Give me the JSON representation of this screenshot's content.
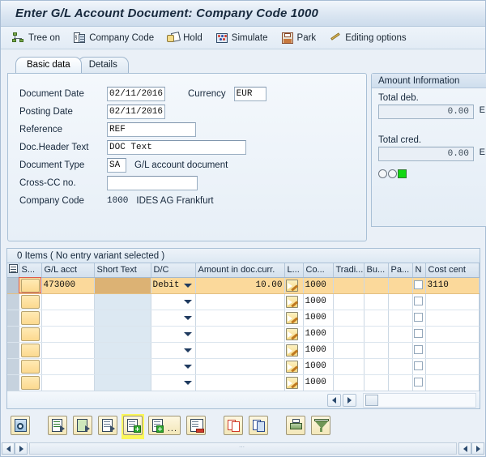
{
  "window": {
    "title": "Enter G/L Account Document: Company Code 1000"
  },
  "toolbar": {
    "items": [
      {
        "label": "Tree on",
        "icon": "tree-icon"
      },
      {
        "label": "Company Code",
        "icon": "company-code-icon"
      },
      {
        "label": "Hold",
        "icon": "hold-icon"
      },
      {
        "label": "Simulate",
        "icon": "simulate-icon"
      },
      {
        "label": "Park",
        "icon": "park-save-icon"
      },
      {
        "label": "Editing options",
        "icon": "pencil-icon"
      }
    ]
  },
  "tabs": [
    {
      "label": "Basic data",
      "active": true
    },
    {
      "label": "Details",
      "active": false
    }
  ],
  "basic_data": {
    "document_date": {
      "label": "Document Date",
      "value": "02/11/2016"
    },
    "currency": {
      "label": "Currency",
      "value": "EUR"
    },
    "posting_date": {
      "label": "Posting Date",
      "value": "02/11/2016"
    },
    "reference": {
      "label": "Reference",
      "value": "REF"
    },
    "doc_header_text": {
      "label": "Doc.Header Text",
      "value": "DOC Text"
    },
    "document_type": {
      "label": "Document Type",
      "value": "SA",
      "description": "G/L account document"
    },
    "cross_cc_no": {
      "label": "Cross-CC no.",
      "value": ""
    },
    "company_code": {
      "label": "Company Code",
      "value": "1000",
      "description": "IDES AG Frankfurt"
    }
  },
  "amount_information": {
    "header": "Amount Information",
    "total_debit": {
      "label": "Total deb.",
      "value": "0.00",
      "currency": "E"
    },
    "total_credit": {
      "label": "Total cred.",
      "value": "0.00",
      "currency": "E"
    },
    "status_light": {
      "red": "off",
      "yellow": "off",
      "green": "on",
      "green_color": "#13d813"
    }
  },
  "items": {
    "status_text": "0 Items ( No entry variant selected )",
    "columns": [
      {
        "key": "icon",
        "label": "",
        "width": 14
      },
      {
        "key": "sel",
        "label": "S...",
        "width": 28
      },
      {
        "key": "glacct",
        "label": "G/L acct",
        "width": 65
      },
      {
        "key": "short",
        "label": "Short Text",
        "width": 70
      },
      {
        "key": "dc",
        "label": "D/C",
        "width": 55
      },
      {
        "key": "amount",
        "label": "Amount in doc.curr.",
        "width": 110
      },
      {
        "key": "l",
        "label": "L...",
        "width": 23
      },
      {
        "key": "co",
        "label": "Co...",
        "width": 37
      },
      {
        "key": "tradi",
        "label": "Tradi...",
        "width": 38
      },
      {
        "key": "bu",
        "label": "Bu...",
        "width": 30
      },
      {
        "key": "pa",
        "label": "Pa...",
        "width": 30
      },
      {
        "key": "n",
        "label": "N",
        "width": 16
      },
      {
        "key": "cost",
        "label": "Cost cent",
        "width": 58
      }
    ],
    "rows": [
      {
        "filled": true,
        "selected": true,
        "glacct": "473000",
        "short": "",
        "dc": "Debit",
        "amount": "10.00",
        "l_icon": "pencil-icon",
        "co": "1000",
        "tradi": "",
        "bu": "",
        "pa": "",
        "n_checked": false,
        "cost": "3110"
      },
      {
        "filled": false,
        "selected": false,
        "glacct": "",
        "short": "",
        "dc": "",
        "amount": "",
        "l_icon": "pencil-icon",
        "co": "1000",
        "tradi": "",
        "bu": "",
        "pa": "",
        "n_checked": false,
        "cost": ""
      },
      {
        "filled": false,
        "selected": false,
        "glacct": "",
        "short": "",
        "dc": "",
        "amount": "",
        "l_icon": "pencil-icon",
        "co": "1000",
        "tradi": "",
        "bu": "",
        "pa": "",
        "n_checked": false,
        "cost": ""
      },
      {
        "filled": false,
        "selected": false,
        "glacct": "",
        "short": "",
        "dc": "",
        "amount": "",
        "l_icon": "pencil-icon",
        "co": "1000",
        "tradi": "",
        "bu": "",
        "pa": "",
        "n_checked": false,
        "cost": ""
      },
      {
        "filled": false,
        "selected": false,
        "glacct": "",
        "short": "",
        "dc": "",
        "amount": "",
        "l_icon": "pencil-icon",
        "co": "1000",
        "tradi": "",
        "bu": "",
        "pa": "",
        "n_checked": false,
        "cost": ""
      },
      {
        "filled": false,
        "selected": false,
        "glacct": "",
        "short": "",
        "dc": "",
        "amount": "",
        "l_icon": "pencil-icon",
        "co": "1000",
        "tradi": "",
        "bu": "",
        "pa": "",
        "n_checked": false,
        "cost": ""
      },
      {
        "filled": false,
        "selected": false,
        "glacct": "",
        "short": "",
        "dc": "",
        "amount": "",
        "l_icon": "pencil-icon",
        "co": "1000",
        "tradi": "",
        "bu": "",
        "pa": "",
        "n_checked": false,
        "cost": ""
      }
    ]
  },
  "grid_toolbar": {
    "buttons": [
      {
        "name": "display-document-overview-button",
        "icon": "magnifier-doc-icon",
        "highlighted": false
      },
      {
        "name": "select-all-lines-button",
        "icon": "doc-green-lines-icon",
        "highlighted": false
      },
      {
        "name": "deselect-all-lines-button",
        "icon": "doc-green-block-icon",
        "highlighted": false
      },
      {
        "name": "select-block-button",
        "icon": "doc-grey-lines-icon",
        "highlighted": false
      },
      {
        "name": "insert-line-button",
        "icon": "doc-insert-plus-icon",
        "highlighted": true
      },
      {
        "name": "insert-line-options-button",
        "icon": "doc-insert-plus-dots-icon",
        "highlighted": false,
        "has_dots": true
      },
      {
        "name": "delete-line-button",
        "icon": "doc-delete-minus-icon",
        "highlighted": false
      },
      {
        "name": "copy-line-button",
        "icon": "copy-red-icon",
        "highlighted": false
      },
      {
        "name": "paste-line-button",
        "icon": "copy-blue-icon",
        "highlighted": false
      },
      {
        "name": "print-button",
        "icon": "printer-icon",
        "highlighted": false
      },
      {
        "name": "filter-button",
        "icon": "funnel-icon",
        "highlighted": false
      }
    ]
  }
}
